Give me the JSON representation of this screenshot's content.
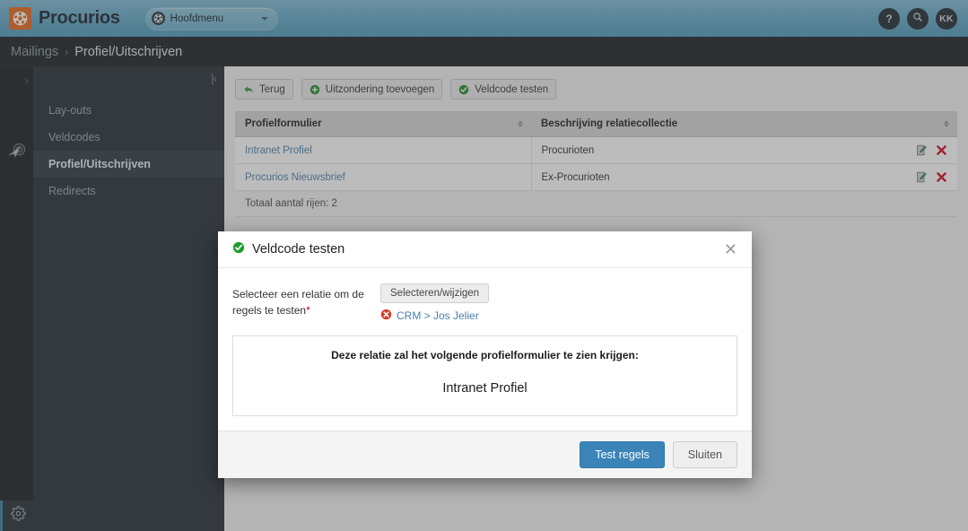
{
  "header": {
    "brand": "Procurios",
    "menu_pill_label": "Hoofdmenu",
    "help_label": "?",
    "search_label": "",
    "avatar_initials": "KK"
  },
  "breadcrumb": {
    "root": "Mailings",
    "separator": "›",
    "current": "Profiel/Uitschrijven"
  },
  "subnav": {
    "collapse_label": "|‹",
    "items": [
      {
        "label": "Lay-outs",
        "active": false
      },
      {
        "label": "Veldcodes",
        "active": false
      },
      {
        "label": "Profiel/Uitschrijven",
        "active": true
      },
      {
        "label": "Redirects",
        "active": false
      }
    ]
  },
  "toolbar": {
    "back_label": "Terug",
    "add_exception_label": "Uitzondering toevoegen",
    "test_fieldcode_label": "Veldcode testen"
  },
  "table": {
    "columns": [
      "Profielformulier",
      "Beschrijving relatiecollectie"
    ],
    "rows": [
      {
        "form": "Intranet Profiel",
        "description": "Procurioten"
      },
      {
        "form": "Procurios Nieuwsbrief",
        "description": "Ex-Procurioten"
      }
    ],
    "total_label": "Totaal aantal rijen: 2"
  },
  "modal": {
    "title": "Veldcode testen",
    "close_label": "✕",
    "form_label": "Selecteer een relatie om de regels te testen",
    "required_marker": "*",
    "select_button": "Selecteren/wijzigen",
    "relation_link": "CRM > Jos Jelier",
    "result_heading": "Deze relatie zal het volgende profielformulier te zien krijgen:",
    "result_value": "Intranet Profiel",
    "primary_button": "Test regels",
    "secondary_button": "Sluiten"
  },
  "colors": {
    "brand_orange": "#e8661a",
    "header_blue": "#62a7c6",
    "accent_blue": "#3a84b8",
    "link_blue": "#4a7fa8",
    "success_green": "#2f9e33",
    "danger_red": "#d0021b"
  }
}
